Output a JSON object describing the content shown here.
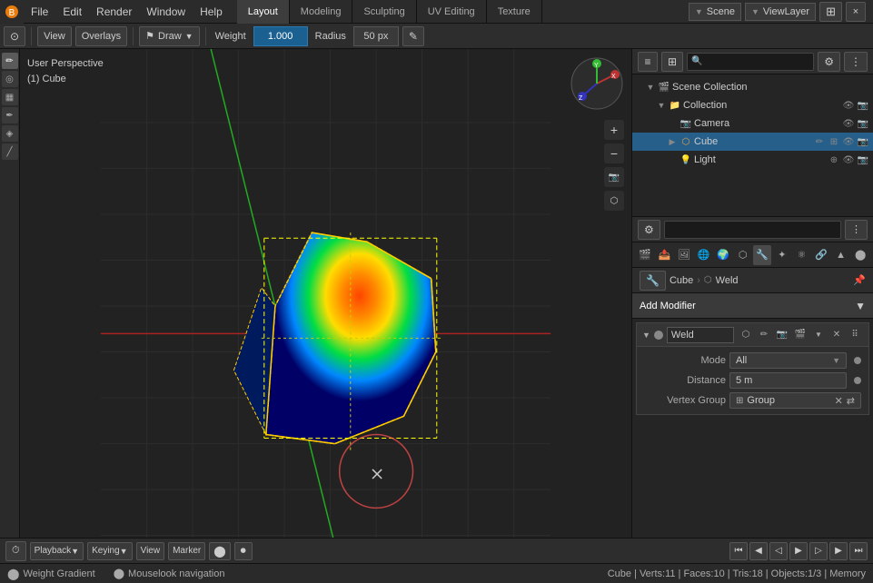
{
  "topbar": {
    "menus": [
      "File",
      "Edit",
      "Render",
      "Window",
      "Help"
    ],
    "workspaces": [
      "Layout",
      "Modeling",
      "Sculpting",
      "UV Editing",
      "Texture"
    ],
    "active_workspace": "Layout",
    "scene": "Scene",
    "viewlayer": "ViewLayer"
  },
  "header": {
    "view_label": "View",
    "overlays_label": "Overlays",
    "draw_mode": "Draw",
    "weight_label": "Weight",
    "weight_value": "1.000",
    "radius_label": "Radius",
    "radius_value": "50 px"
  },
  "viewport": {
    "perspective_label": "User Perspective",
    "object_label": "(1) Cube",
    "gizmo_x": "X",
    "gizmo_y": "Y",
    "gizmo_z": "Z"
  },
  "outliner": {
    "title": "Scene Collection",
    "items": [
      {
        "label": "Scene Collection",
        "type": "scene",
        "indent": 0
      },
      {
        "label": "Collection",
        "type": "collection",
        "indent": 1,
        "expanded": true
      },
      {
        "label": "Camera",
        "type": "camera",
        "indent": 2
      },
      {
        "label": "Cube",
        "type": "mesh",
        "indent": 2,
        "selected": true
      },
      {
        "label": "Light",
        "type": "light",
        "indent": 2
      }
    ]
  },
  "properties": {
    "breadcrumb": {
      "object": "Cube",
      "separator": "›",
      "modifier": "Weld"
    },
    "add_modifier_label": "Add Modifier",
    "modifier": {
      "name": "Weld",
      "mode_label": "Mode",
      "mode_value": "All",
      "distance_label": "Distance",
      "distance_value": "5 m",
      "vertex_group_label": "Vertex Group",
      "vertex_group_value": "Group"
    }
  },
  "timeline": {
    "playback_label": "Playback",
    "keying_label": "Keying",
    "view_label": "View",
    "marker_label": "Marker"
  },
  "statusbar": {
    "gradient_label": "Weight Gradient",
    "mouselook_label": "Mouselook navigation",
    "stats": "Cube | Verts:11 | Faces:10 | Tris:18 | Objects:1/3 | Memory"
  }
}
